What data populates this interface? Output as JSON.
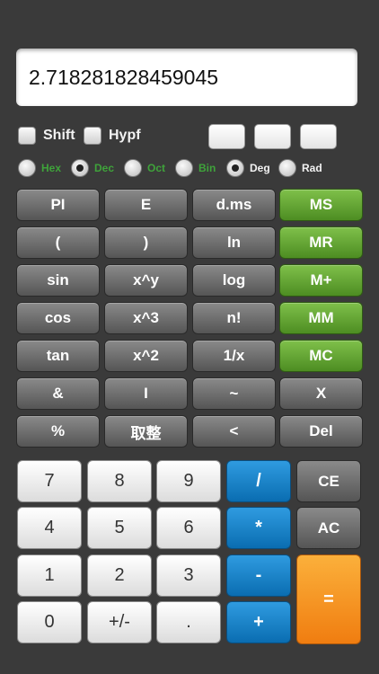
{
  "display": {
    "value": "2.718281828459045"
  },
  "toggles": {
    "shift": "Shift",
    "hypf": "Hypf"
  },
  "radios": {
    "hex": "Hex",
    "dec": "Dec",
    "oct": "Oct",
    "bin": "Bin",
    "deg": "Deg",
    "rad": "Rad",
    "selected_base": "Dec",
    "selected_angle": "Deg"
  },
  "sci_buttons": [
    [
      "PI",
      "E",
      "d.ms",
      "MS"
    ],
    [
      "(",
      ")",
      "ln",
      "MR"
    ],
    [
      "sin",
      "x^y",
      "log",
      "M+"
    ],
    [
      "cos",
      "x^3",
      "n!",
      "MM"
    ],
    [
      "tan",
      "x^2",
      "1/x",
      "MC"
    ],
    [
      "&",
      "I",
      "~",
      "X"
    ],
    [
      "%",
      "取整",
      "<",
      "Del"
    ]
  ],
  "keypad": {
    "digits": [
      [
        "7",
        "8",
        "9"
      ],
      [
        "4",
        "5",
        "6"
      ],
      [
        "1",
        "2",
        "3"
      ],
      [
        "0",
        "+/-",
        "."
      ]
    ],
    "ops": [
      "/",
      "*",
      "-",
      "+"
    ],
    "ce": "CE",
    "ac": "AC",
    "equals": "="
  },
  "colors": {
    "memory_green": "#5fa22f",
    "op_blue": "#1a84cc",
    "equals_orange": "#f7941d",
    "base_green": "#3fa33a"
  }
}
